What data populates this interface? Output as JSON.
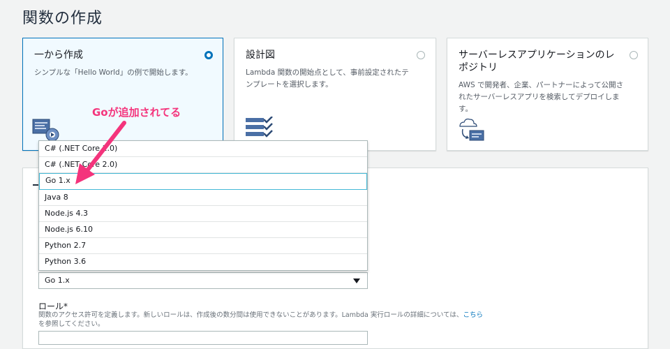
{
  "page": {
    "title": "関数の作成"
  },
  "cards": {
    "scratch": {
      "title": "一から作成",
      "desc": "シンプルな「Hello World」の例で開始します。",
      "selected": true
    },
    "blueprint": {
      "title": "設計図",
      "desc_line1": "Lambda 関数の開始点として、事前設定されたテ",
      "desc_line2": "ンプレートを選択します。",
      "selected": false
    },
    "repository": {
      "title_line1": "サーバーレスアプリケーションのレ",
      "title_line2": "ポジトリ",
      "desc_line1": "AWS で開発者、企業、パートナーによって公開さ",
      "desc_line2": "れたサーバーレスアプリを検索してデプロイしま",
      "desc_line3": "す。",
      "selected": false
    }
  },
  "annotation": {
    "text": "Goが追加されてる",
    "color": "#f4347c"
  },
  "runtime": {
    "options": [
      "C# (.NET Core 1.0)",
      "C# (.NET Core 2.0)",
      "Go 1.x",
      "Java 8",
      "Node.js 4.3",
      "Node.js 6.10",
      "Python 2.7",
      "Python 3.6"
    ],
    "highlighted": "Go 1.x",
    "selected_value": "Go 1.x"
  },
  "role": {
    "label": "ロール*",
    "desc_prefix": "関数のアクセス許可を定義します。新しいロールは、作成後の数分間は使用できないことがあります。Lambda 実行ロールの詳細については、",
    "desc_link": "こちら",
    "desc_suffix": "を参照してください。"
  },
  "colors": {
    "accent": "#0073bb",
    "annotation": "#f4347c",
    "highlight_border": "#44b9d6"
  }
}
